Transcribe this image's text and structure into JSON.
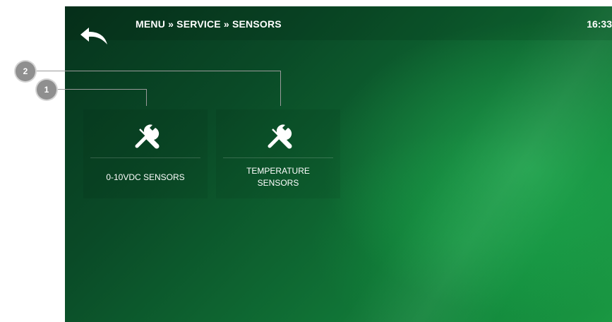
{
  "header": {
    "breadcrumb": "MENU » SERVICE » SENSORS",
    "time": "16:33",
    "back_icon": "back-arrow-icon"
  },
  "tiles": [
    {
      "label": "0-10VDC SENSORS",
      "icon": "tools-icon"
    },
    {
      "label": "TEMPERATURE\nSENSORS",
      "icon": "tools-icon"
    }
  ],
  "callouts": [
    {
      "number": "1"
    },
    {
      "number": "2"
    }
  ],
  "colors": {
    "background_dark": "#0a4a27",
    "background_light": "#1a9842",
    "text": "#ffffff",
    "callout": "#8f8f8f"
  }
}
